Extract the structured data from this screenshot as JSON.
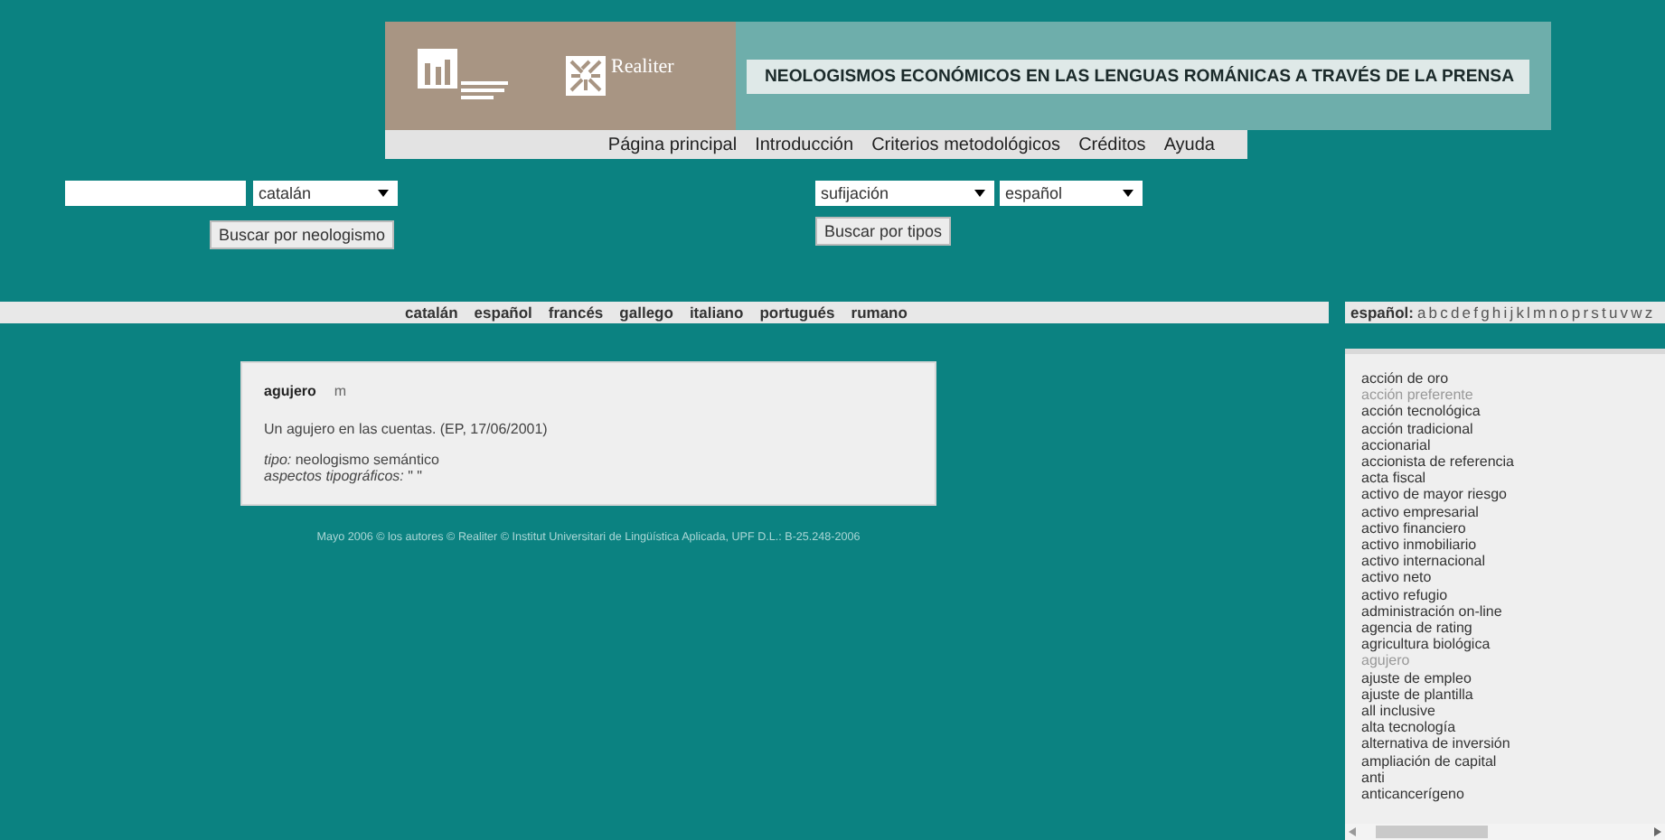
{
  "header": {
    "logo_text": "Realiter",
    "title": "NEOLOGISMOS ECONÓMICOS EN LAS LENGUAS ROMÁNICAS A TRAVÉS DE LA PRENSA",
    "nav": [
      "Página principal",
      "Introducción",
      "Criterios metodológicos",
      "Créditos",
      "Ayuda"
    ]
  },
  "word_search": {
    "language": "catalán",
    "button": "Buscar por neologismo"
  },
  "type_search": {
    "type": "sufijación",
    "language": "español",
    "button": "Buscar por tipos"
  },
  "languages": [
    "catalán",
    "español",
    "francés",
    "gallego",
    "italiano",
    "portugués",
    "rumano"
  ],
  "alphabet": {
    "label": "español:",
    "letters": [
      "a",
      "b",
      "c",
      "d",
      "e",
      "f",
      "g",
      "h",
      "i",
      "j",
      "k",
      "l",
      "m",
      "n",
      "o",
      "p",
      "r",
      "s",
      "t",
      "u",
      "v",
      "w",
      "z"
    ]
  },
  "entry": {
    "headword": "agujero",
    "category": "m",
    "example": "Un agujero en las cuentas. (EP, 17/06/2001)",
    "type_label": "tipo:",
    "type_value": "neologismo semántico",
    "typo_label": "aspectos tipográficos:",
    "typo_value": "\" \""
  },
  "footer": "Mayo 2006 © los autores © Realiter © Institut Universitari de Lingüística Aplicada, UPF D.L.: B-25.248-2006",
  "word_list": [
    {
      "text": "acción de oro",
      "visited": false
    },
    {
      "text": "acción preferente",
      "visited": true
    },
    {
      "text": "acción tecnológica",
      "visited": false
    },
    {
      "text": "acción tradicional",
      "visited": false
    },
    {
      "text": "accionarial",
      "visited": false
    },
    {
      "text": "accionista de referencia",
      "visited": false
    },
    {
      "text": "acta fiscal",
      "visited": false
    },
    {
      "text": "activo de mayor riesgo",
      "visited": false
    },
    {
      "text": "activo empresarial",
      "visited": false
    },
    {
      "text": "activo financiero",
      "visited": false
    },
    {
      "text": "activo inmobiliario",
      "visited": false
    },
    {
      "text": "activo internacional",
      "visited": false
    },
    {
      "text": "activo neto",
      "visited": false
    },
    {
      "text": "activo refugio",
      "visited": false
    },
    {
      "text": "administración on-line",
      "visited": false
    },
    {
      "text": "agencia de rating",
      "visited": false
    },
    {
      "text": "agricultura biológica",
      "visited": false
    },
    {
      "text": "agujero",
      "visited": true
    },
    {
      "text": "ajuste de empleo",
      "visited": false
    },
    {
      "text": "ajuste de plantilla",
      "visited": false
    },
    {
      "text": "all inclusive",
      "visited": false
    },
    {
      "text": "alta tecnología",
      "visited": false
    },
    {
      "text": "alternativa de inversión",
      "visited": false
    },
    {
      "text": "ampliación de capital",
      "visited": false
    },
    {
      "text": "anti",
      "visited": false
    },
    {
      "text": "anticancerígeno",
      "visited": false
    }
  ]
}
